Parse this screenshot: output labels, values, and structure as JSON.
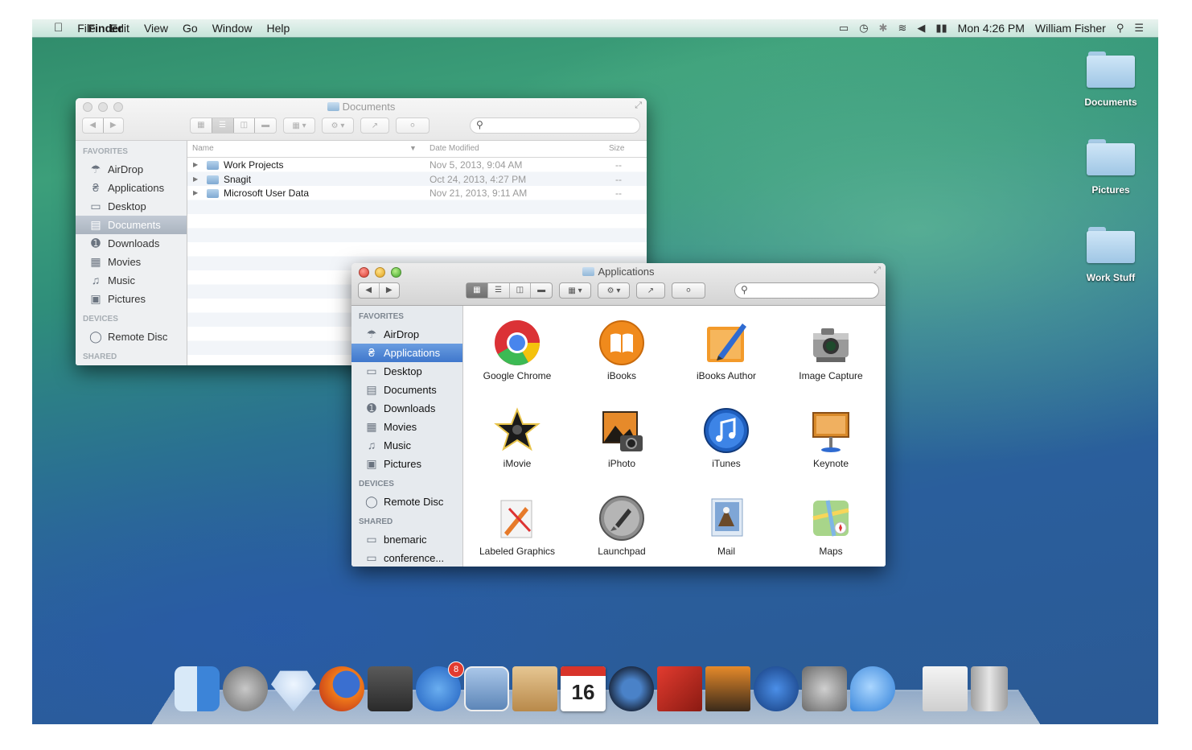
{
  "menubar": {
    "apple": "",
    "app_name": "Finder",
    "menus": [
      "File",
      "Edit",
      "View",
      "Go",
      "Window",
      "Help"
    ],
    "clock": "Mon 4:26 PM",
    "user": "William Fisher"
  },
  "desktop": {
    "folders": [
      "Documents",
      "Pictures",
      "Work Stuff"
    ]
  },
  "documents_window": {
    "title": "Documents",
    "sidebar": {
      "favorites_header": "FAVORITES",
      "favorites": [
        "AirDrop",
        "Applications",
        "Desktop",
        "Documents",
        "Downloads",
        "Movies",
        "Music",
        "Pictures"
      ],
      "devices_header": "DEVICES",
      "devices": [
        "Remote Disc"
      ],
      "shared_header": "SHARED"
    },
    "columns": {
      "name": "Name",
      "date": "Date Modified",
      "size": "Size"
    },
    "rows": [
      {
        "name": "Work Projects",
        "date": "Nov 5, 2013, 9:04 AM",
        "size": "--"
      },
      {
        "name": "Snagit",
        "date": "Oct 24, 2013, 4:27 PM",
        "size": "--"
      },
      {
        "name": "Microsoft User Data",
        "date": "Nov 21, 2013, 9:11 AM",
        "size": "--"
      }
    ]
  },
  "applications_window": {
    "title": "Applications",
    "sidebar": {
      "favorites_header": "FAVORITES",
      "favorites": [
        "AirDrop",
        "Applications",
        "Desktop",
        "Documents",
        "Downloads",
        "Movies",
        "Music",
        "Pictures"
      ],
      "devices_header": "DEVICES",
      "devices": [
        "Remote Disc"
      ],
      "shared_header": "SHARED",
      "shared": [
        "bnemaric",
        "conference..."
      ]
    },
    "apps": [
      "Google Chrome",
      "iBooks",
      "iBooks Author",
      "Image Capture",
      "iMovie",
      "iPhoto",
      "iTunes",
      "Keynote",
      "Labeled Graphics",
      "Launchpad",
      "Mail",
      "Maps"
    ]
  },
  "dock": {
    "app_store_badge": "8",
    "calendar_day": "16"
  },
  "colors": {
    "selection_blue": "#3f77cc",
    "chrome_red": "#db3236",
    "ibooks_orange": "#f08a1c",
    "itunes_blue": "#1f5fbf"
  }
}
